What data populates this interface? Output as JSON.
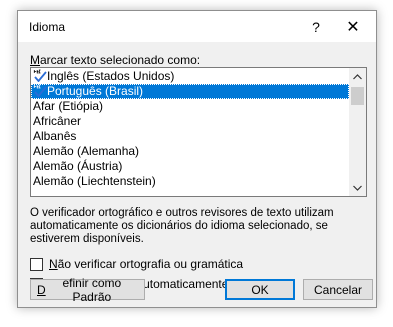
{
  "window": {
    "title": "Idioma",
    "help_label": "?",
    "close_label": "✕"
  },
  "list": {
    "label_accel": "M",
    "label_rest": "arcar texto selecionado como:",
    "items": [
      {
        "label": "Inglês (Estados Unidos)",
        "spellcheck": true,
        "selected": false
      },
      {
        "label": "Português (Brasil)",
        "spellcheck": true,
        "selected": true
      },
      {
        "label": "Afar (Etiópia)",
        "spellcheck": false,
        "selected": false
      },
      {
        "label": "Africâner",
        "spellcheck": false,
        "selected": false
      },
      {
        "label": "Albanês",
        "spellcheck": false,
        "selected": false
      },
      {
        "label": "Alemão (Alemanha)",
        "spellcheck": false,
        "selected": false
      },
      {
        "label": "Alemão (Áustria)",
        "spellcheck": false,
        "selected": false
      },
      {
        "label": "Alemão (Liechtenstein)",
        "spellcheck": false,
        "selected": false
      }
    ],
    "scroll_position": 0.02
  },
  "info_text": "O verificador ortográfico e outros revisores de texto utilizam automaticamente os dicionários do idioma selecionado, se estiverem disponíveis.",
  "options": {
    "no_spellcheck": {
      "accel": "N",
      "rest": "ão verificar ortografia ou gramática",
      "checked": false
    },
    "detect_language": {
      "pre": "D",
      "accel": "e",
      "rest": "tectar idioma automaticamente",
      "checked": true
    }
  },
  "buttons": {
    "set_default_accel": "D",
    "set_default_rest": "efinir como Padrão",
    "ok": "OK",
    "cancel": "Cancelar"
  },
  "colors": {
    "selection": "#0078d7",
    "dialog_bg": "#f0f0f0"
  }
}
